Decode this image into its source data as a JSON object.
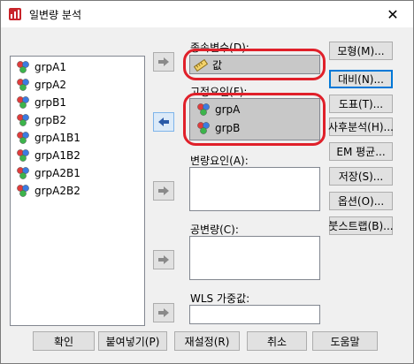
{
  "window": {
    "title": "일변량 분석",
    "close_glyph": "✕"
  },
  "source_list": {
    "items": [
      "grpA1",
      "grpA2",
      "grpB1",
      "grpB2",
      "grpA1B1",
      "grpA1B2",
      "grpA2B1",
      "grpA2B2"
    ]
  },
  "dependent": {
    "label": "종속변수(D):",
    "value": "값"
  },
  "fixed_factors": {
    "label": "고정요인(F):",
    "items": [
      "grpA",
      "grpB"
    ]
  },
  "random_factors": {
    "label": "변량요인(A):"
  },
  "covariates": {
    "label": "공변량(C):"
  },
  "wls": {
    "label": "WLS 가중값:"
  },
  "side_buttons": [
    "모형(M)...",
    "대비(N)...",
    "도표(T)...",
    "사후분석(H)...",
    "EM 평균...",
    "저장(S)...",
    "옵션(O)...",
    "붓스트랩(B)..."
  ],
  "bottom_buttons": [
    "확인",
    "붙여넣기(P)",
    "재설정(R)",
    "취소",
    "도움말"
  ],
  "colors": {
    "highlight": "#e0202a",
    "selection": "#c8c8c8",
    "accent": "#0078d7"
  }
}
